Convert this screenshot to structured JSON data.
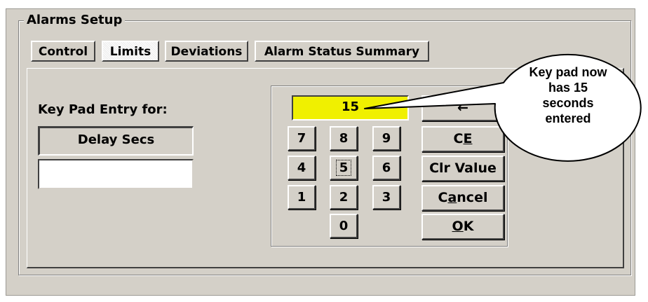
{
  "group_title": "Alarms Setup",
  "tabs": [
    {
      "label": "Control"
    },
    {
      "label": "Limits"
    },
    {
      "label": "Deviations"
    },
    {
      "label": "Alarm Status Summary"
    }
  ],
  "active_tab": "Limits",
  "keypad_entry_label": "Key Pad Entry for:",
  "field_name": "Delay Secs",
  "field_value": "",
  "display_value": "15",
  "digit_keys": [
    "7",
    "8",
    "9",
    "4",
    "5",
    "6",
    "1",
    "2",
    "3",
    "0"
  ],
  "function_buttons": [
    {
      "label": "←"
    },
    {
      "label": "CE",
      "mnemonic": "E"
    },
    {
      "label": "Clr Value"
    },
    {
      "label": "Cancel",
      "mnemonic": "a"
    },
    {
      "label": "OK",
      "mnemonic": "O"
    }
  ],
  "callout": {
    "text": "Key pad now\nhas 15\nseconds\nentered"
  },
  "colors": {
    "window_bg": "#d4d0c8",
    "display_bg": "#f0f000"
  }
}
